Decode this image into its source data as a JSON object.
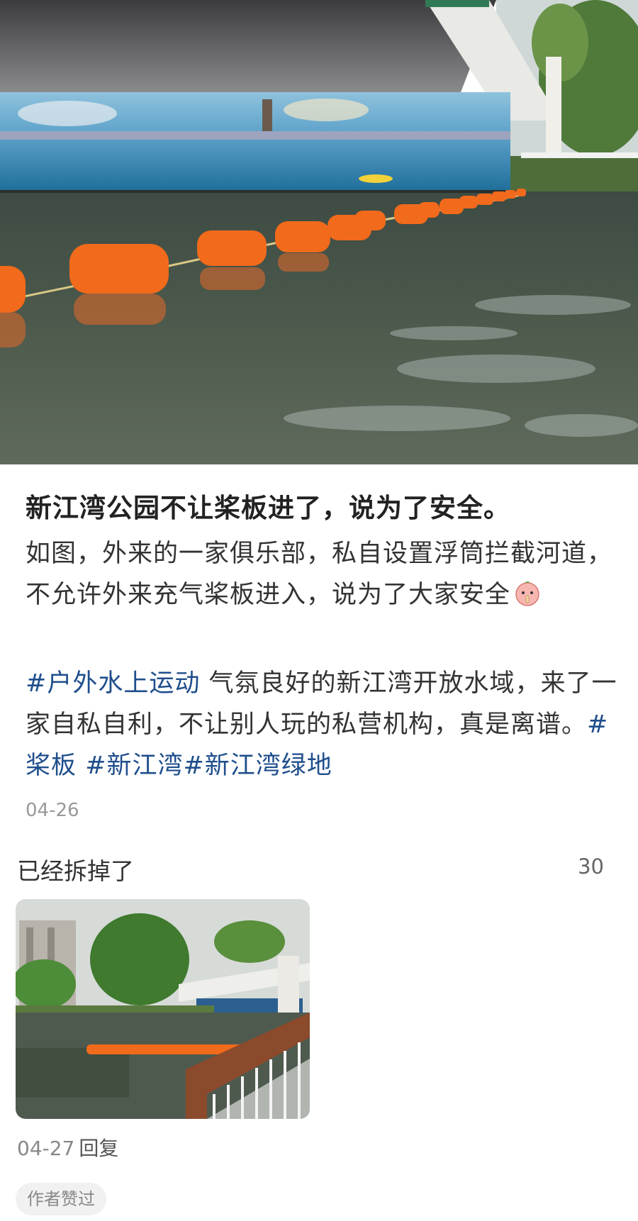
{
  "post": {
    "title": "新江湾公园不让桨板进了，说为了安全。",
    "body_line1": "如图，外来的一家俱乐部，私自设置浮筒拦截河道，",
    "body_line2": "不允许外来充气桨板进入，说为了大家安全",
    "emoji": "shush-face-icon",
    "tag_outdoor": "#户外水上运动",
    "tags_text1": " 气氛良好的新江湾开放水域，来了一",
    "tags_text2": "家自私自利，不让别人玩的私营机构，真是离谱。",
    "tag_hash_end": "#",
    "tag_paddle": "桨板",
    "tag_xjw": "#新江湾",
    "tag_xjw_green": "#新江湾绿地",
    "date": "04-26"
  },
  "comment": {
    "text": "已经拆掉了",
    "likes": "30",
    "date": "04-27",
    "reply_label": "回复",
    "author_badge": "作者赞过"
  },
  "colors": {
    "tag": "#1f4e8c",
    "buoy": "#f26a1b",
    "water": "#4a5a46"
  }
}
